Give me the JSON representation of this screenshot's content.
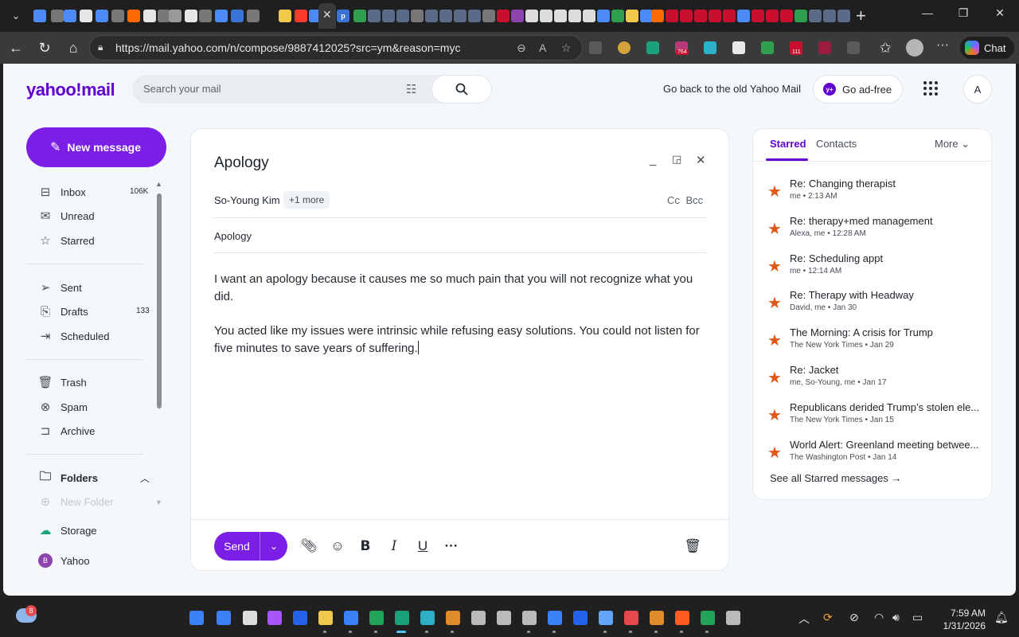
{
  "browser": {
    "url": "https://mail.yahoo.com/n/compose/9887412025?src=ym&reason=myc",
    "copilot_label": "Chat",
    "extension_badges": [
      "764",
      "111"
    ]
  },
  "header": {
    "logo": "yahoo!mail",
    "search_placeholder": "Search your mail",
    "old_mail_link": "Go back to the old Yahoo Mail",
    "adfree_label": "Go ad-free",
    "adfree_logo": "y+",
    "avatar_initial": "A"
  },
  "sidebar": {
    "new_message_label": "New message",
    "items": [
      {
        "label": "Inbox",
        "count": "106K",
        "icon": "inbox-icon"
      },
      {
        "label": "Unread",
        "count": "",
        "icon": "unread-icon"
      },
      {
        "label": "Starred",
        "count": "",
        "icon": "star-icon"
      },
      {
        "label": "Sent",
        "count": "",
        "icon": "sent-icon"
      },
      {
        "label": "Drafts",
        "count": "133",
        "icon": "drafts-icon"
      },
      {
        "label": "Scheduled",
        "count": "",
        "icon": "scheduled-icon"
      },
      {
        "label": "Trash",
        "count": "",
        "icon": "trash-icon"
      },
      {
        "label": "Spam",
        "count": "",
        "icon": "spam-icon"
      },
      {
        "label": "Archive",
        "count": "",
        "icon": "archive-icon"
      }
    ],
    "folders_label": "Folders",
    "new_folder_label": "New Folder",
    "storage_label": "Storage",
    "yahoo_label": "Yahoo",
    "yahoo_avatar": "B"
  },
  "compose": {
    "title": "Apology",
    "to_name": "So-Young Kim",
    "to_more": "+1 more",
    "cc_bcc": "Cc Bcc",
    "subject": "Apology",
    "body": [
      "I want an apology because it causes me so much pain that you will not recognize what you did.",
      "You acted like my issues were intrinsic while refusing easy solutions. You could not listen for five minutes to save years of suffering."
    ],
    "send_label": "Send"
  },
  "right_panel": {
    "tabs": [
      "Starred",
      "Contacts"
    ],
    "more_label": "More",
    "messages": [
      {
        "subject": "Re: Changing therapist",
        "meta": "me • 2:13 AM"
      },
      {
        "subject": "Re: therapy+med management",
        "meta": "Alexa, me • 12:28 AM"
      },
      {
        "subject": "Re: Scheduling appt",
        "meta": "me • 12:14 AM"
      },
      {
        "subject": "Re: Therapy with Headway",
        "meta": "David, me • Jan 30"
      },
      {
        "subject": "The Morning: A crisis for Trump",
        "meta": "The New York Times • Jan 29"
      },
      {
        "subject": "Re: Jacket",
        "meta": "me, So-Young, me • Jan 17"
      },
      {
        "subject": "Republicans derided Trump’s stolen ele...",
        "meta": "The New York Times • Jan 15"
      },
      {
        "subject": "World Alert: Greenland meeting betwee...",
        "meta": "The Washington Post • Jan 14"
      }
    ],
    "see_all": "See all Starred messages"
  },
  "taskbar": {
    "notification_count": "8",
    "time": "7:59 AM",
    "date": "1/31/2026"
  },
  "colors": {
    "accent": "#7b1fe6",
    "brand": "#6001d2",
    "star": "#e0571a"
  }
}
